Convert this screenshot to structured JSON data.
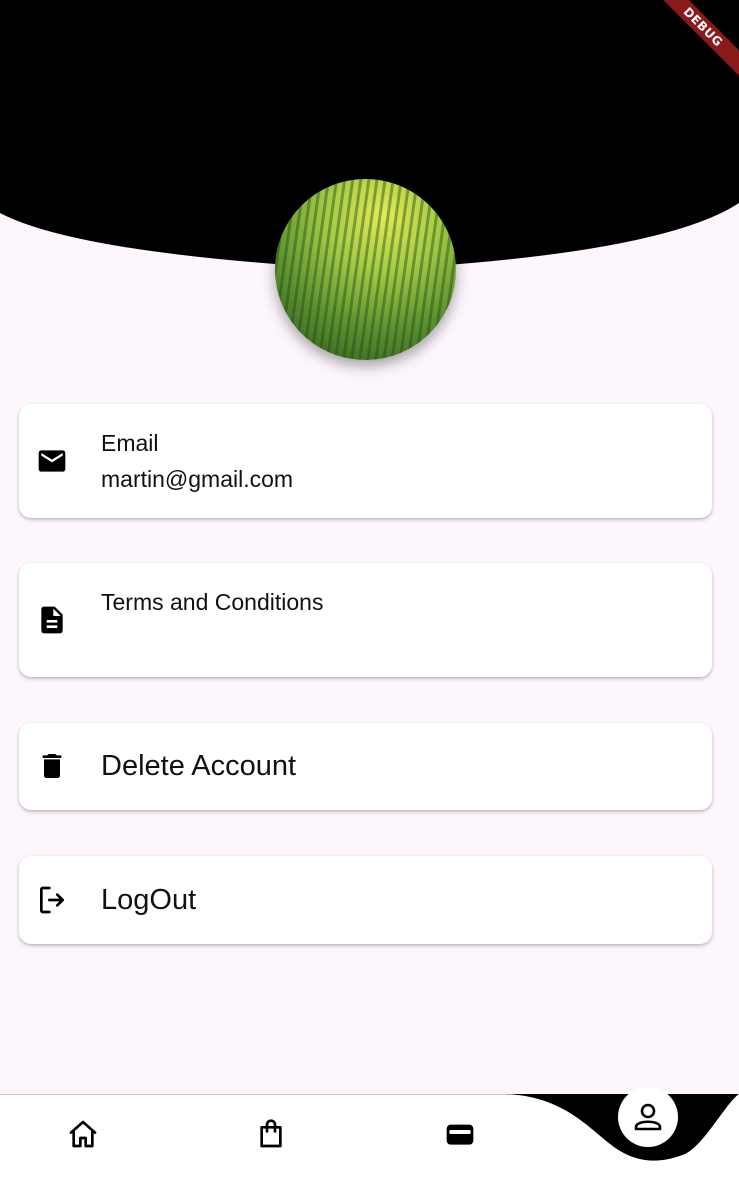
{
  "header": {
    "debug_label": "DEBUG"
  },
  "profile": {
    "avatar_description": "cornfield aerial photo"
  },
  "cards": {
    "email": {
      "label": "Email",
      "value": "martin@gmail.com",
      "icon": "mail-icon"
    },
    "terms": {
      "label": "Terms and Conditions",
      "icon": "document-icon"
    },
    "delete": {
      "label": "Delete Account",
      "icon": "trash-icon"
    },
    "logout": {
      "label": "LogOut",
      "icon": "logout-icon"
    }
  },
  "bottom_nav": {
    "items": [
      {
        "icon": "home-icon"
      },
      {
        "icon": "shopping-bag-icon"
      },
      {
        "icon": "wallet-icon"
      },
      {
        "icon": "person-icon",
        "active": true
      }
    ]
  },
  "colors": {
    "background": "#fdf6fd",
    "header": "#000000",
    "card": "#ffffff",
    "debug_ribbon": "#8b1a1a"
  }
}
